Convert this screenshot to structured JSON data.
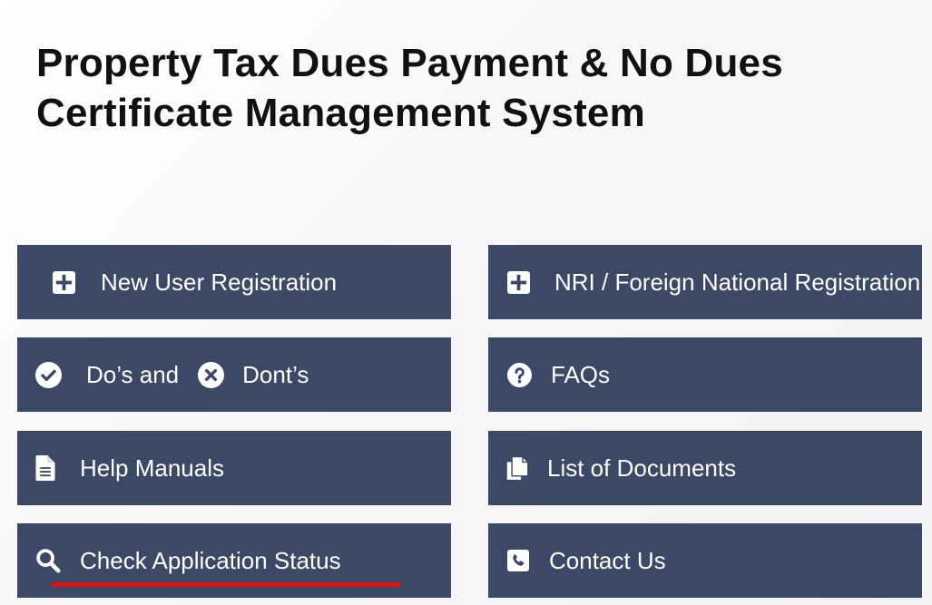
{
  "page": {
    "title_line1": "Property Tax Dues Payment & No Dues",
    "title_line2": "Certificate Management System"
  },
  "menu": {
    "new_user_registration": {
      "label": "New User Registration",
      "icon": "plus-square-icon"
    },
    "nri_registration": {
      "label": "NRI / Foreign National Registration",
      "icon": "plus-square-icon"
    },
    "dos_and_donts": {
      "label_dos": "Do’s and",
      "label_donts": "Dont’s",
      "icon_dos": "check-circle-icon",
      "icon_donts": "x-circle-icon"
    },
    "faqs": {
      "label": "FAQs",
      "icon": "question-circle-icon"
    },
    "help_manuals": {
      "label": "Help Manuals",
      "icon": "file-text-icon"
    },
    "list_of_documents": {
      "label": "List of Documents",
      "icon": "files-icon"
    },
    "check_application_status": {
      "label": "Check Application Status",
      "icon": "search-icon"
    },
    "contact_us": {
      "label": "Contact Us",
      "icon": "phone-square-icon"
    }
  },
  "colors": {
    "button_bg": "#3b4866",
    "button_text": "#ffffff",
    "title_text": "#111111",
    "underline_accent": "#d9151c"
  }
}
